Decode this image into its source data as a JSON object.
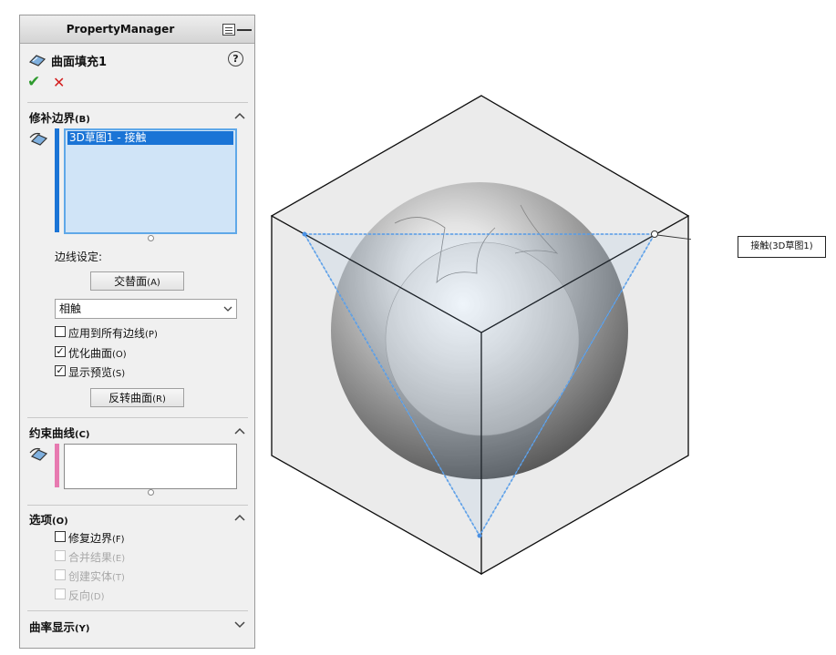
{
  "panel": {
    "title": "PropertyManager",
    "feature_title": "曲面填充1",
    "help_label": "?",
    "ok_label": "✔",
    "cancel_label": "✕"
  },
  "patch_boundary": {
    "title": "修补边界",
    "shortcut": "(B)",
    "items": [
      "3D草图1 - 接触"
    ],
    "edge_settings_label": "边线设定:",
    "alternate_face_button": "交替面",
    "alternate_face_shortcut": "(A)",
    "curvature_control": "相触",
    "apply_all_edges": {
      "label": "应用到所有边线",
      "shortcut": "(P)",
      "checked": false
    },
    "optimize_surface": {
      "label": "优化曲面",
      "shortcut": "(O)",
      "checked": true
    },
    "show_preview": {
      "label": "显示预览",
      "shortcut": "(S)",
      "checked": true
    },
    "reverse_surface_button": "反转曲面",
    "reverse_surface_shortcut": "(R)"
  },
  "constraint_curves": {
    "title": "约束曲线",
    "shortcut": "(C)"
  },
  "options": {
    "title": "选项",
    "shortcut": "(O)",
    "fix_boundary": {
      "label": "修复边界",
      "shortcut": "(F)",
      "checked": false,
      "enabled": true
    },
    "merge_result": {
      "label": "合并结果",
      "shortcut": "(E)",
      "checked": false,
      "enabled": false
    },
    "create_solid": {
      "label": "创建实体",
      "shortcut": "(T)",
      "checked": false,
      "enabled": false
    },
    "reverse": {
      "label": "反向",
      "shortcut": "(D)",
      "checked": false,
      "enabled": false
    }
  },
  "curvature_display": {
    "title": "曲率显示",
    "shortcut": "(Y)"
  },
  "viewport": {
    "callout_label": "接触(3D草图1)"
  },
  "colors": {
    "accent_blue": "#1a74d6",
    "selection_fill": "#d0e4f7",
    "ok_green": "#2e9a2e",
    "cancel_red": "#d42020",
    "constraint_pink": "#e77ab0"
  }
}
